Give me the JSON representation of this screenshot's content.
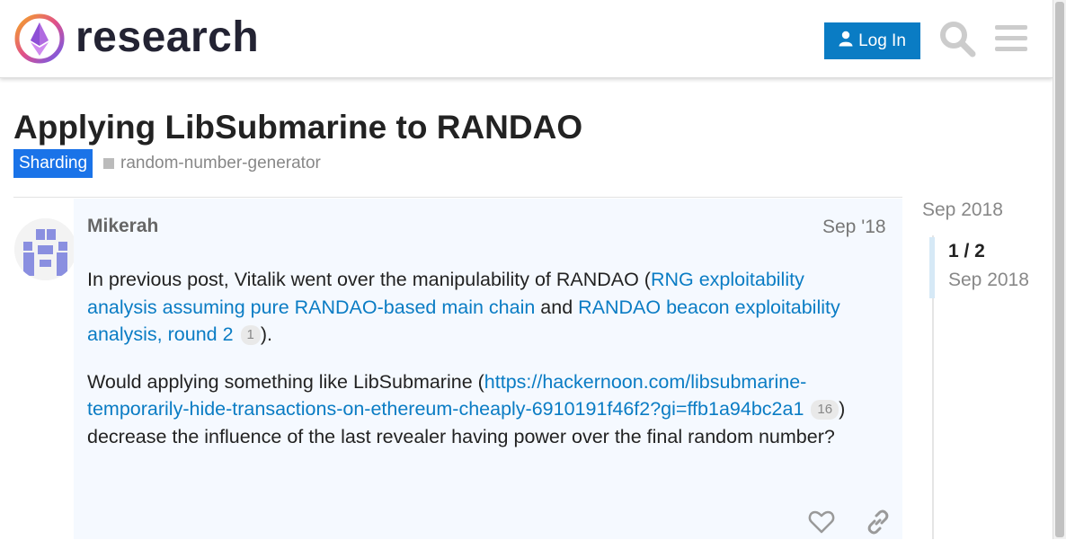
{
  "header": {
    "site_name": "research",
    "login_label": "Log In",
    "icons": [
      "logo-icon",
      "user-icon",
      "search-icon",
      "hamburger-menu-icon"
    ],
    "colors": {
      "primary": "#0a7cc4",
      "text": "#232333"
    }
  },
  "topic": {
    "title": "Applying LibSubmarine to RANDAO",
    "category": "Sharding",
    "category_color": "#1a73e8",
    "tag": "random-number-generator"
  },
  "post": {
    "author": "Mikerah",
    "date": "Sep '18",
    "p1_before": "In previous post, Vitalik went over the manipulability of RANDAO (",
    "p1_link1": "RNG exploitability analysis assuming pure RANDAO-based main chain",
    "p1_mid": " and ",
    "p1_link2": "RANDAO beacon exploitability analysis, round 2",
    "p1_link2_count": "1",
    "p1_after": ").",
    "p2_before": "Would applying something like LibSubmarine (",
    "p2_link": "https://hackernoon.com/libsubmarine-temporarily-hide-transactions-on-ethereum-cheaply-6910191f46f2?gi=ffb1a94bc2a1",
    "p2_link_count": "16",
    "p2_after_close": ")",
    "p2_after": "decrease the influence of the last revealer having power over the final random number?",
    "actions": [
      "heart-icon",
      "link-icon"
    ]
  },
  "timeline": {
    "top_date": "Sep 2018",
    "position": "1 / 2",
    "current_date": "Sep 2018"
  }
}
